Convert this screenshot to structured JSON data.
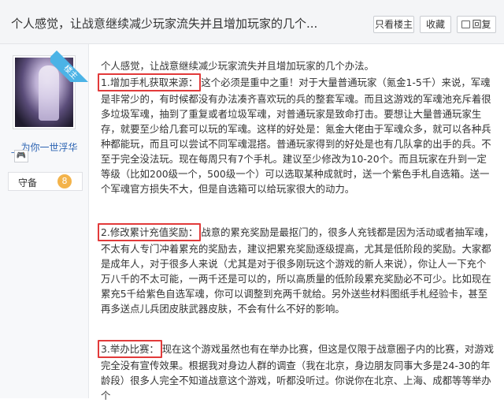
{
  "header": {
    "title": "个人感觉，让战意继续减少玩家流失并且增加玩家的几个...",
    "only_author_label": "只看楼主",
    "favorite_label": "收藏",
    "reply_label": "回复"
  },
  "user": {
    "corner_badge": "楼主",
    "username": "__为你一世浮华",
    "level_name": "守备",
    "level_number": "8"
  },
  "post": {
    "intro": "个人感觉，让战意继续减少玩家流失并且增加玩家的几个办法。",
    "sections": [
      {
        "heading": "1.增加手札获取来源：",
        "body": "这个必须是重中之重！对于大量普通玩家（氪金1-5千）来说，军魂是非常少的，有时候都没有办法凑齐喜欢玩的兵的整套军魂。而且这游戏的军魂池充斥着很多垃圾军魂，抽到了重复或者垃圾军魂，对普通玩家是致命打击。要想让大量普通玩家生存，就要至少给几套可以玩的军魂。这样的好处是：氪金大佬由于军魂众多，就可以各种兵种都能玩，而且可以尝试不同军魂混搭。普通玩家得到的好处是也有几队拿的出手的兵。不至于完全没法玩。现在每周只有7个手札。建议至少修改为10-20个。而且玩家在升到一定等级（比如200级一个，500级一个）可以选取某种成就时，送一个紫色手札自选箱。送一个军魂官方损失不大，但是自选箱可以给玩家很大的动力。"
      },
      {
        "heading": "2.修改累计充值奖励：",
        "body": "战意的累充奖励是最抠门的，很多人充钱都是因为活动或者抽军魂，不太有人专门冲着累充的奖励去，建议把累充奖励逐级提高，尤其是低阶段的奖励。大家都是成年人，对于很多人来说（尤其是对于很多刚玩这个游戏的新人来说），你让人一下充个万八千的不太可能，一两千还是可以的，所以高质量的低阶段累充奖励必不可少。比如现在累充5千给紫色自选军魂，你可以调整到充两千就给。另外送些材料图纸手札经验卡，甚至再多送点儿兵团皮肤武器皮肤，不会有什么不好的影响。"
      },
      {
        "heading": "3.举办比赛：",
        "body": "现在这个游戏虽然也有在举办比赛，但这是仅限于战意圈子内的比赛，对游戏完全没有宣传效果。根据我对身边人群的调查（我在北京，身边朋友同事大多是24-30的年龄段）很多人完全不知道战意这个游戏，听都没听过。你说你在北京、上海、成都等等举办个"
      }
    ]
  },
  "colors": {
    "highlight_border": "#e23a3a",
    "link_blue": "#2d64b3",
    "corner_badge": "#4bb3e6",
    "level_badge": "#f3b34a"
  }
}
